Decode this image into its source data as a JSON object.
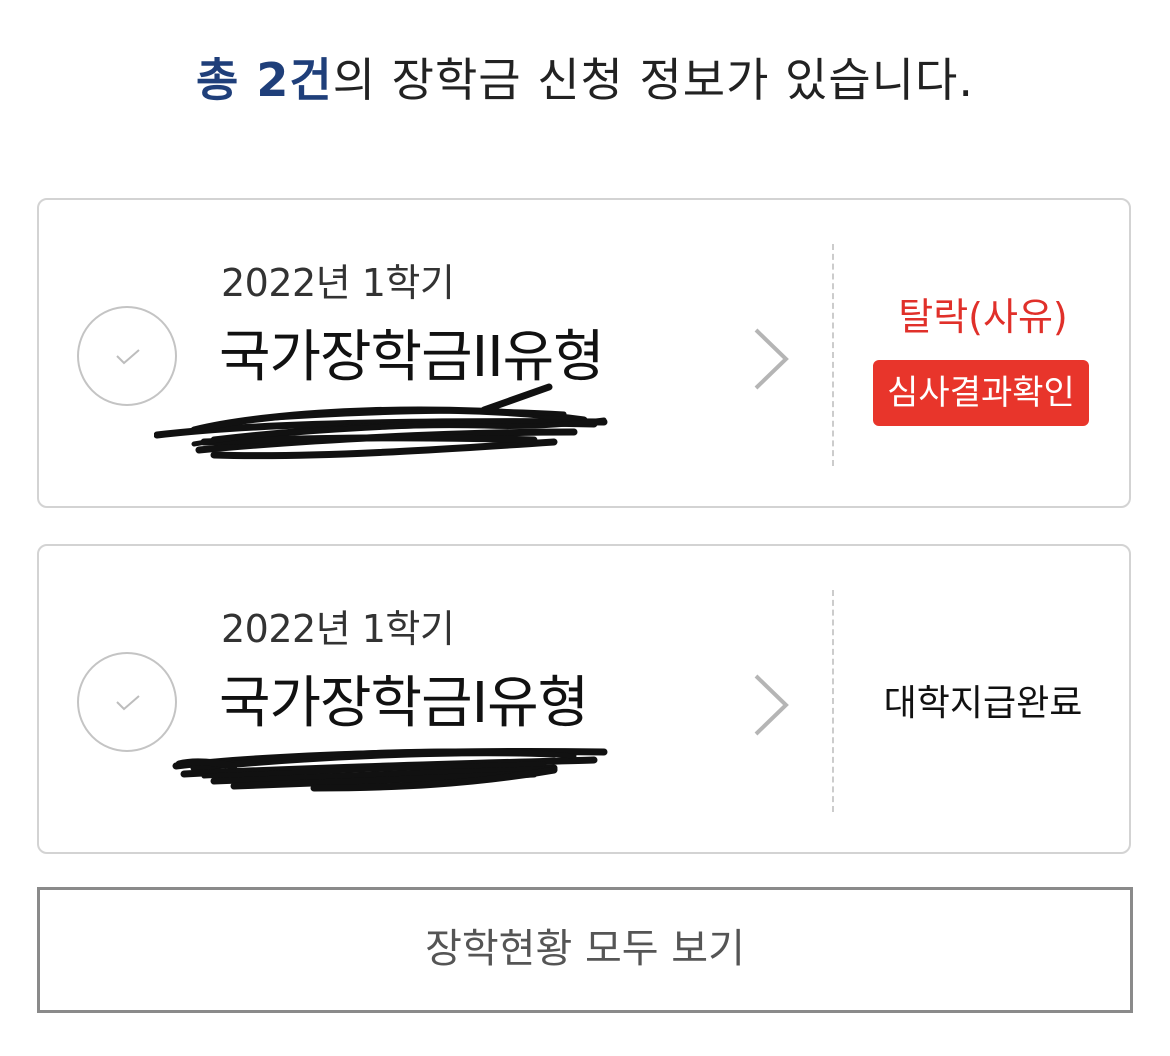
{
  "summary": {
    "accent_text": "총 2건",
    "rest_text": "의 장학금 신청 정보가 있습니다."
  },
  "applications": [
    {
      "semester": "2022년 1학기",
      "name": "국가장학금II유형",
      "status": "탈락(사유)",
      "status_color": "#e0302a",
      "action_button": "심사결과확인",
      "action_color": "#e8352b"
    },
    {
      "semester": "2022년 1학기",
      "name": "국가장학금I유형",
      "status": "대학지급완료"
    }
  ],
  "view_all_button": "장학현황 모두 보기",
  "icons": {
    "check": "check-icon",
    "chevron": "chevron-right-icon"
  },
  "colors": {
    "accent": "#1f3f7a",
    "status_fail": "#e0302a"
  }
}
